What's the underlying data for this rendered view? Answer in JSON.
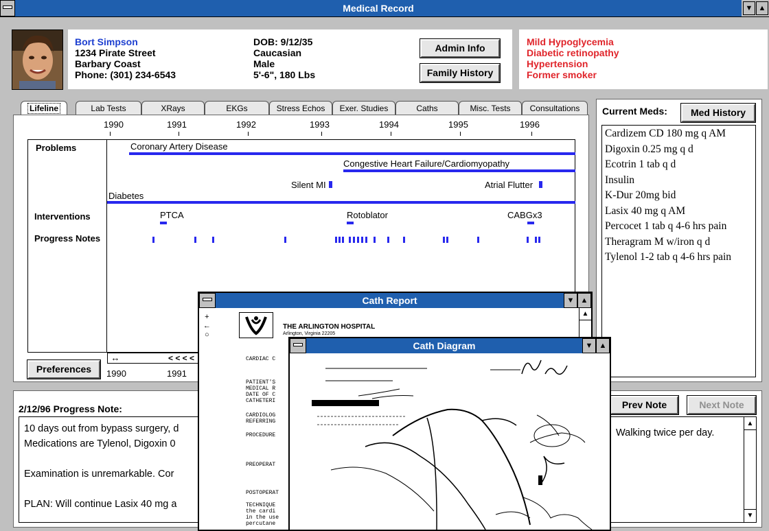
{
  "window": {
    "title": "Medical Record"
  },
  "patient": {
    "name": "Bort Simpson",
    "street": "1234 Pirate Street",
    "city": "Barbary Coast",
    "phone": "Phone: (301) 234-6543",
    "dob": "DOB: 9/12/35",
    "race": "Caucasian",
    "sex": "Male",
    "height_weight": "5'-6\", 180 Lbs"
  },
  "buttons": {
    "admin": "Admin Info",
    "family": "Family History",
    "med_history": "Med History",
    "preferences": "Preferences",
    "prev_note": "Prev Note",
    "next_note": "Next Note"
  },
  "conditions": [
    "Mild Hypoglycemia",
    "Diabetic retinopathy",
    "Hypertension",
    "Former smoker"
  ],
  "tabs": [
    "Lifeline",
    "Lab Tests",
    "XRays",
    "EKGs",
    "Stress Echos",
    "Exer. Studies",
    "Caths",
    "Misc. Tests",
    "Consultations"
  ],
  "timeline": {
    "years": [
      "1990",
      "1991",
      "1992",
      "1993",
      "1994",
      "1995",
      "1996"
    ],
    "row_labels": [
      "Problems",
      "Interventions",
      "Progress Notes"
    ],
    "problems": [
      "Coronary Artery Disease",
      "Congestive Heart Failure/Cardiomyopathy",
      "Silent MI",
      "Atrial Flutter",
      "Diabetes"
    ],
    "interventions": [
      "PTCA",
      "Rotoblator",
      "CABGx3"
    ],
    "bottom_years": [
      "1990",
      "1991"
    ],
    "scroll_arrows": "< < < <"
  },
  "meds": {
    "title": "Current Meds:",
    "items": [
      "Cardizem CD 180 mg q AM",
      "Digoxin 0.25 mg q d",
      "Ecotrin 1 tab q d",
      "Insulin",
      "K-Dur 20mg bid",
      "Lasix 40 mg q AM",
      "Percocet 1 tab q 4-6 hrs pain",
      "Theragram M w/iron q d",
      "Tylenol 1-2 tab q 4-6 hrs pain"
    ]
  },
  "progress_note": {
    "title": "2/12/96 Progress Note:",
    "lines": [
      "10 days out from bypass surgery, d",
      "Medications are Tylenol, Digoxin 0",
      "Examination is unremarkable.  Cor",
      "PLAN:  Will continue Lasix 40 mg a"
    ],
    "right_text": "Walking twice per day."
  },
  "cath_report": {
    "title": "Cath Report",
    "hospital": "THE ARLINGTON HOSPITAL",
    "address": "Arlington, Virginia 22205",
    "doc_lines": [
      "CARDIAC C",
      "PATIENT'S",
      "MEDICAL R",
      "DATE OF C",
      "CATHETERI",
      "CARDIOLOG",
      "REFERRING",
      "PROCEDURE",
      "PREOPERAT",
      "POSTOPERAT",
      "TECHNIQUE",
      "the cardi",
      "in the use",
      "percutane"
    ]
  },
  "cath_diagram": {
    "title": "Cath Diagram"
  }
}
